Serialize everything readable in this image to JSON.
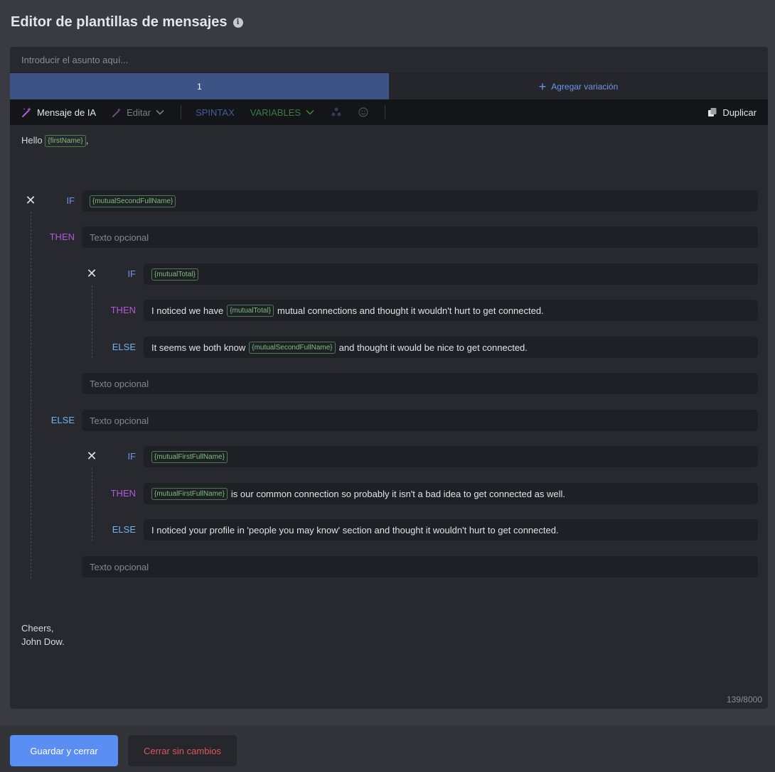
{
  "page": {
    "title": "Editor de plantillas de mensajes"
  },
  "subject": {
    "placeholder": "Introducir el asunto aquí..."
  },
  "variations": {
    "active_tab": "1",
    "add_label": "Agregar variación"
  },
  "toolbar": {
    "ai_message": "Mensaje de IA",
    "edit": "Editar",
    "spintax": "SPINTAX",
    "variables": "VARIABLES",
    "duplicate": "Duplicar"
  },
  "body": {
    "greeting": "Hello",
    "greeting_var": "{firstName}",
    "greeting_suffix": ",",
    "outer_if_var": "{mutualSecondFullName}",
    "kw_if": "IF",
    "kw_then": "THEN",
    "kw_else": "ELSE",
    "optional_placeholder": "Texto opcional",
    "inner1_if_var": "{mutualTotal}",
    "inner1_then_pre": "I noticed we have",
    "inner1_then_var": "{mutualTotal}",
    "inner1_then_post": "mutual connections and thought it wouldn't hurt to get connected.",
    "inner1_else_pre": "It seems we both know",
    "inner1_else_var": "{mutualSecondFullName}",
    "inner1_else_post": "and thought it would be nice to get connected.",
    "inner2_if_var": "{mutualFirstFullName}",
    "inner2_then_var": "{mutualFirstFullName}",
    "inner2_then_post": "is our common connection so probably it isn't a bad idea to get connected as well.",
    "inner2_else_text": "I noticed your profile in 'people you may know' section and thought it wouldn't hurt to get connected.",
    "signoff_line1": "Cheers,",
    "signoff_line2": "John Dow.",
    "char_count": "139/8000"
  },
  "footer": {
    "save": "Guardar y cerrar",
    "cancel": "Cerrar sin cambios"
  },
  "colors": {
    "accent": "#5b8ef2",
    "active_tab": "#3d5385",
    "danger": "#e0545a",
    "variable_chip": "#7bbf7a",
    "keyword_if": "#6f95e8",
    "keyword_then": "#b25ad8",
    "keyword_else": "#6fb5f0"
  }
}
